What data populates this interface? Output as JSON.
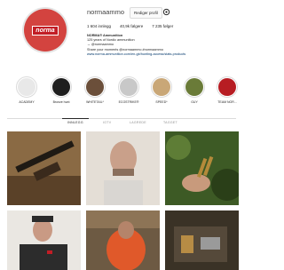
{
  "profile": {
    "username": "normaammo",
    "edit_button": "Rediger profil",
    "stats": {
      "posts": "1 604 innlegg",
      "followers": "40,9k følgere",
      "following": "7 235 følger"
    },
    "bio": {
      "name": "NORMA® Ammunition",
      "line1": "125 years of Nordic ammunition",
      "line2": "→ @normaammo",
      "line3": "Share your moments @normaammo #normaammo",
      "link": "www.norma-ammunition.com/en-gb/hunting-access/stats-products"
    }
  },
  "highlights": [
    {
      "label": "ACADEMY",
      "color": "#e8e8e8"
    },
    {
      "label": "Bronze hunt",
      "color": "#1e1e1e"
    },
    {
      "label": "WHITETAIL*",
      "color": "#6b4f3a"
    },
    {
      "label": "ECOSTRIKE®",
      "color": "#c8c8c8"
    },
    {
      "label": "SPEED*",
      "color": "#c9a777"
    },
    {
      "label": "GUY",
      "color": "#6a7b38"
    },
    {
      "label": "TEAM NOR...",
      "color": "#b71d23"
    }
  ],
  "tabs": [
    "INNLEGG",
    "IGTV",
    "LAGREDE",
    "TAGGET"
  ],
  "grid_tiles": [
    {
      "name": "rifle-post",
      "colors": [
        "#7a5a3a",
        "#3b2b1f"
      ]
    },
    {
      "name": "man-portrait-post",
      "colors": [
        "#dad4cc",
        "#9f8d7d"
      ]
    },
    {
      "name": "cartridges-hand-post",
      "colors": [
        "#3e5a24",
        "#1f2e12"
      ]
    },
    {
      "name": "man-cap-post",
      "colors": [
        "#e8e4de",
        "#2b2b2b"
      ]
    },
    {
      "name": "hunter-orange-post",
      "colors": [
        "#6d5a43",
        "#e0592a"
      ]
    },
    {
      "name": "gear-post",
      "colors": [
        "#4a3e2e",
        "#23201a"
      ]
    }
  ]
}
